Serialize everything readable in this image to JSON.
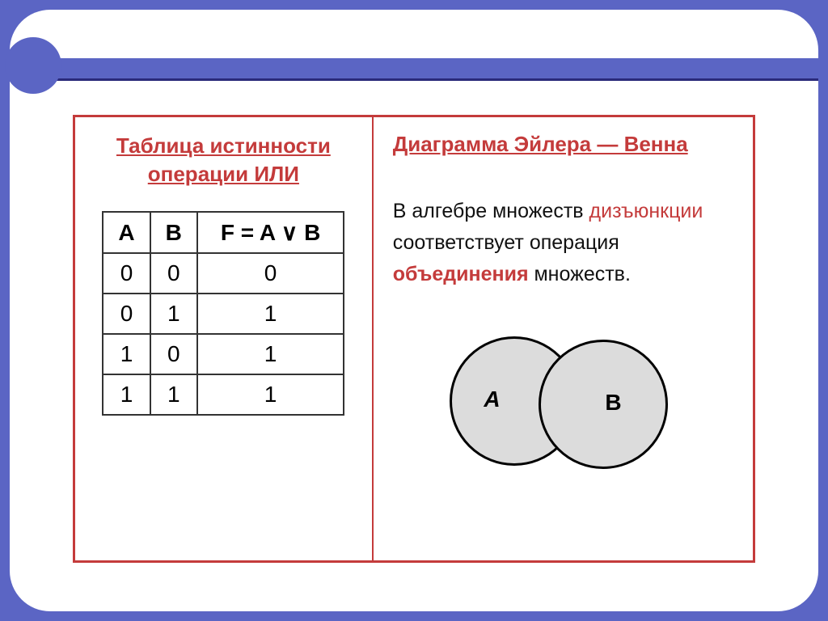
{
  "left": {
    "title_line1": "Таблица истинности",
    "title_line2": "операции ИЛИ",
    "table": {
      "header": {
        "a": "А",
        "b": "В",
        "f": "F = A ∨ B"
      },
      "rows": [
        {
          "a": "0",
          "b": "0",
          "f": "0"
        },
        {
          "a": "0",
          "b": "1",
          "f": "1"
        },
        {
          "a": "1",
          "b": "0",
          "f": "1"
        },
        {
          "a": "1",
          "b": "1",
          "f": "1"
        }
      ]
    }
  },
  "right": {
    "title": "Диаграмма Эйлера — Венна",
    "desc": {
      "p1_a": "В алгебре множеств ",
      "p1_b": "дизъюнкции",
      "p1_c": "  соответствует операция ",
      "p1_d": "объединения",
      "p1_e": " множеств."
    },
    "venn": {
      "a": "A",
      "b": "B"
    }
  },
  "chart_data": {
    "type": "table",
    "title": "Таблица истинности операции ИЛИ (дизъюнкция)",
    "columns": [
      "A",
      "B",
      "F = A ∨ B"
    ],
    "rows": [
      [
        0,
        0,
        0
      ],
      [
        0,
        1,
        1
      ],
      [
        1,
        0,
        1
      ],
      [
        1,
        1,
        1
      ]
    ],
    "venn": {
      "sets": [
        "A",
        "B"
      ],
      "shaded_region": "A ∪ B",
      "meaning": "объединение множеств"
    }
  }
}
